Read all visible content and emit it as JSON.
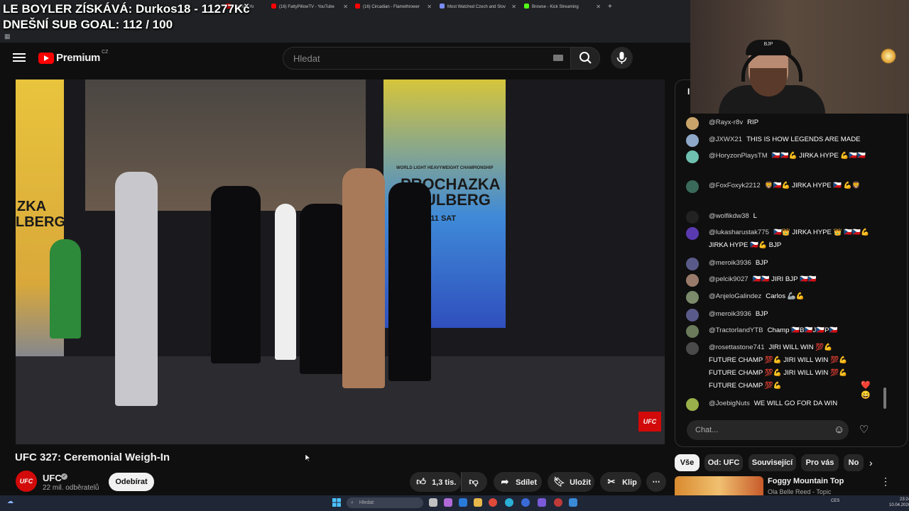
{
  "overlay": {
    "line1": "LE BOYLER ZÍSKÁVÁ: Durkos18 - 11277Kč",
    "line2": "DNEŠNÍ SUB GOAL: 112 / 100"
  },
  "browser_tabs": [
    {
      "label": "...ablo - Yo",
      "icon_color": "#ff0000"
    },
    {
      "label": "(16) FattyPillowTV - YouTube",
      "icon_color": "#ff0000"
    },
    {
      "label": "(16) Circadian - Flamethrower",
      "icon_color": "#ff0000"
    },
    {
      "label": "Most Watched Czech and Slov",
      "icon_color": "#7b8cff"
    },
    {
      "label": "Browse - Kick Streaming",
      "icon_color": "#53fc18"
    }
  ],
  "youtube": {
    "logo_text": "Premium",
    "country": "CZ",
    "search_placeholder": "Hledat"
  },
  "video": {
    "title": "UFC 327: Ceremonial Weigh-In",
    "screen_text_top": "WORLD LIGHT HEAVYWEIGHT CHAMPIONSHIP",
    "screen_text_a": "PROCHAZKA",
    "screen_text_vs": "vs",
    "screen_text_b": "ULBERG",
    "screen_text_date": "APR 11 SAT",
    "screen_left_a": "ZKA",
    "screen_left_b": "LBERG",
    "watermark": "UFC"
  },
  "channel": {
    "avatar_text": "UFC",
    "name": "UFC",
    "subscribers": "22 mil. odběratelů",
    "subscribe_label": "Odebírat"
  },
  "actions": {
    "likes": "1,3 tis.",
    "share": "Sdílet",
    "save": "Uložit",
    "clip": "Klip",
    "more": "⋯"
  },
  "webcam": {
    "cap_text": "BJP"
  },
  "chat": {
    "header_initial": "I",
    "messages": [
      {
        "user": "@Rayx-r8v",
        "text": "RIP",
        "avatar_color": "#c9a46a"
      },
      {
        "user": "@JXWX21",
        "text": "THIS IS HOW LEGENDS ARE MADE",
        "avatar_color": "#8da8c8"
      },
      {
        "user": "@HoryzonPlaysTM",
        "text": "🇨🇿🇨🇿💪 JIRKA HYPE 💪🇨🇿🇨🇿",
        "avatar_color": "#6fc0b0"
      },
      {
        "user": "@FoxFoxyk2212",
        "text": "🦁🇨🇿💪 JIRKA HYPE 🇨🇿 💪🦁",
        "avatar_color": "#3a6a5a"
      },
      {
        "user": "@wolfikdw38",
        "text": "L",
        "avatar_color": "#222222"
      },
      {
        "user": "@lukasharustak775",
        "text": "🇨🇿👑 JIRKA HYPE 👑 🇨🇿🇨🇿💪 JIRKA HYPE 🇨🇿💪 BJP",
        "avatar_color": "#5a3ab0"
      },
      {
        "user": "@meroik3936",
        "text": "BJP",
        "avatar_color": "#5a5a8a"
      },
      {
        "user": "@pelcik9027",
        "text": "🇨🇿🇨🇿 JIRI BJP 🇨🇿🇨🇿",
        "avatar_color": "#9a7a6a"
      },
      {
        "user": "@AnjeloGalindez",
        "text": "Carlos 🦾💪",
        "avatar_color": "#7a8a6a"
      },
      {
        "user": "@meroik3936",
        "text": "BJP",
        "avatar_color": "#5a5a8a"
      },
      {
        "user": "@TractorlandYTB",
        "text": "Champ 🇨🇿B🇨🇿J🇨🇿P🇨🇿",
        "avatar_color": "#6a7a5a"
      },
      {
        "user": "@rosettastone741",
        "text": "JIRI WILL WIN 💯💪 FUTURE CHAMP 💯💪 JIRI WILL WIN 💯💪 FUTURE CHAMP 💯💪 JIRI WILL WIN 💯💪 FUTURE CHAMP 💯💪",
        "avatar_color": "#4a4a4a"
      },
      {
        "user": "@JoebigNuts",
        "text": "WE WILL GO FOR DA WIN",
        "avatar_color": "#9ab04a"
      }
    ],
    "input_placeholder": "Chat...",
    "floating_reactions": "❤️😄"
  },
  "chips": [
    "Vše",
    "Od: UFC",
    "Související",
    "Pro vás",
    "No"
  ],
  "recommendation": {
    "title": "Foggy Mountain Top",
    "subtitle": "Ola Belle Reed - Topic"
  },
  "taskbar": {
    "search_placeholder": "Hledat",
    "lang": "CES",
    "time": "23:24",
    "date": "10.04.2026"
  },
  "colors": {
    "accent": "#ff0000",
    "ufc_red": "#d20a0a",
    "background": "#0f0f0f"
  }
}
